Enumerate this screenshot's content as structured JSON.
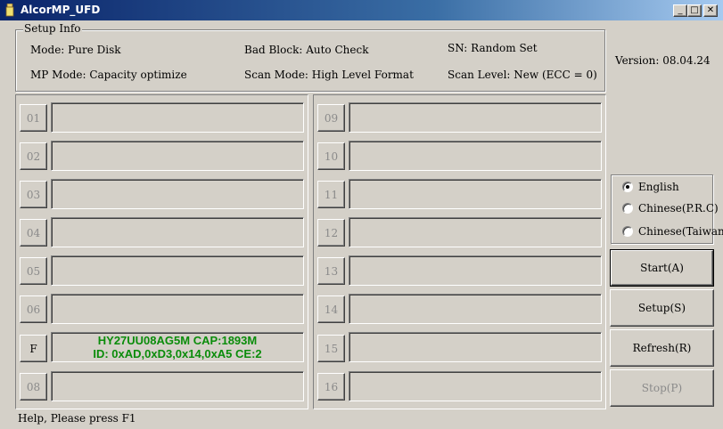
{
  "window": {
    "title": "AlcorMP_UFD",
    "minimize_glyph": "_",
    "maximize_glyph": "□",
    "close_glyph": "✕"
  },
  "setup_info": {
    "legend": "Setup Info",
    "mode": "Mode: Pure Disk",
    "bad_block": "Bad Block: Auto Check",
    "sn": "SN: Random Set",
    "mp_mode": "MP Mode: Capacity optimize",
    "scan_mode": "Scan Mode: High Level Format",
    "scan_level": "Scan Level: New (ECC = 0)"
  },
  "version": "Version: 08.04.24",
  "slots_left": [
    {
      "label": "01",
      "line1": "",
      "line2": ""
    },
    {
      "label": "02",
      "line1": "",
      "line2": ""
    },
    {
      "label": "03",
      "line1": "",
      "line2": ""
    },
    {
      "label": "04",
      "line1": "",
      "line2": ""
    },
    {
      "label": "05",
      "line1": "",
      "line2": ""
    },
    {
      "label": "06",
      "line1": "",
      "line2": ""
    },
    {
      "label": "F",
      "line1": "HY27UU08AG5M CAP:1893M",
      "line2": "ID: 0xAD,0xD3,0x14,0xA5  CE:2"
    },
    {
      "label": "08",
      "line1": "",
      "line2": ""
    }
  ],
  "slots_right": [
    {
      "label": "09"
    },
    {
      "label": "10"
    },
    {
      "label": "11"
    },
    {
      "label": "12"
    },
    {
      "label": "13"
    },
    {
      "label": "14"
    },
    {
      "label": "15"
    },
    {
      "label": "16"
    }
  ],
  "language": {
    "options": [
      "English",
      "Chinese(P.R.C)",
      "Chinese(Taiwan)"
    ],
    "selected": "English"
  },
  "buttons": {
    "start": "Start(A)",
    "setup": "Setup(S)",
    "refresh": "Refresh(R)",
    "stop": "Stop(P)"
  },
  "status_bar": "Help, Please press F1",
  "colors": {
    "face": "#d4d0c8",
    "title_start": "#0a246a",
    "title_end": "#a6caf0",
    "slot_text": "#0a8c0a",
    "disabled_text": "#8a8a8a"
  }
}
